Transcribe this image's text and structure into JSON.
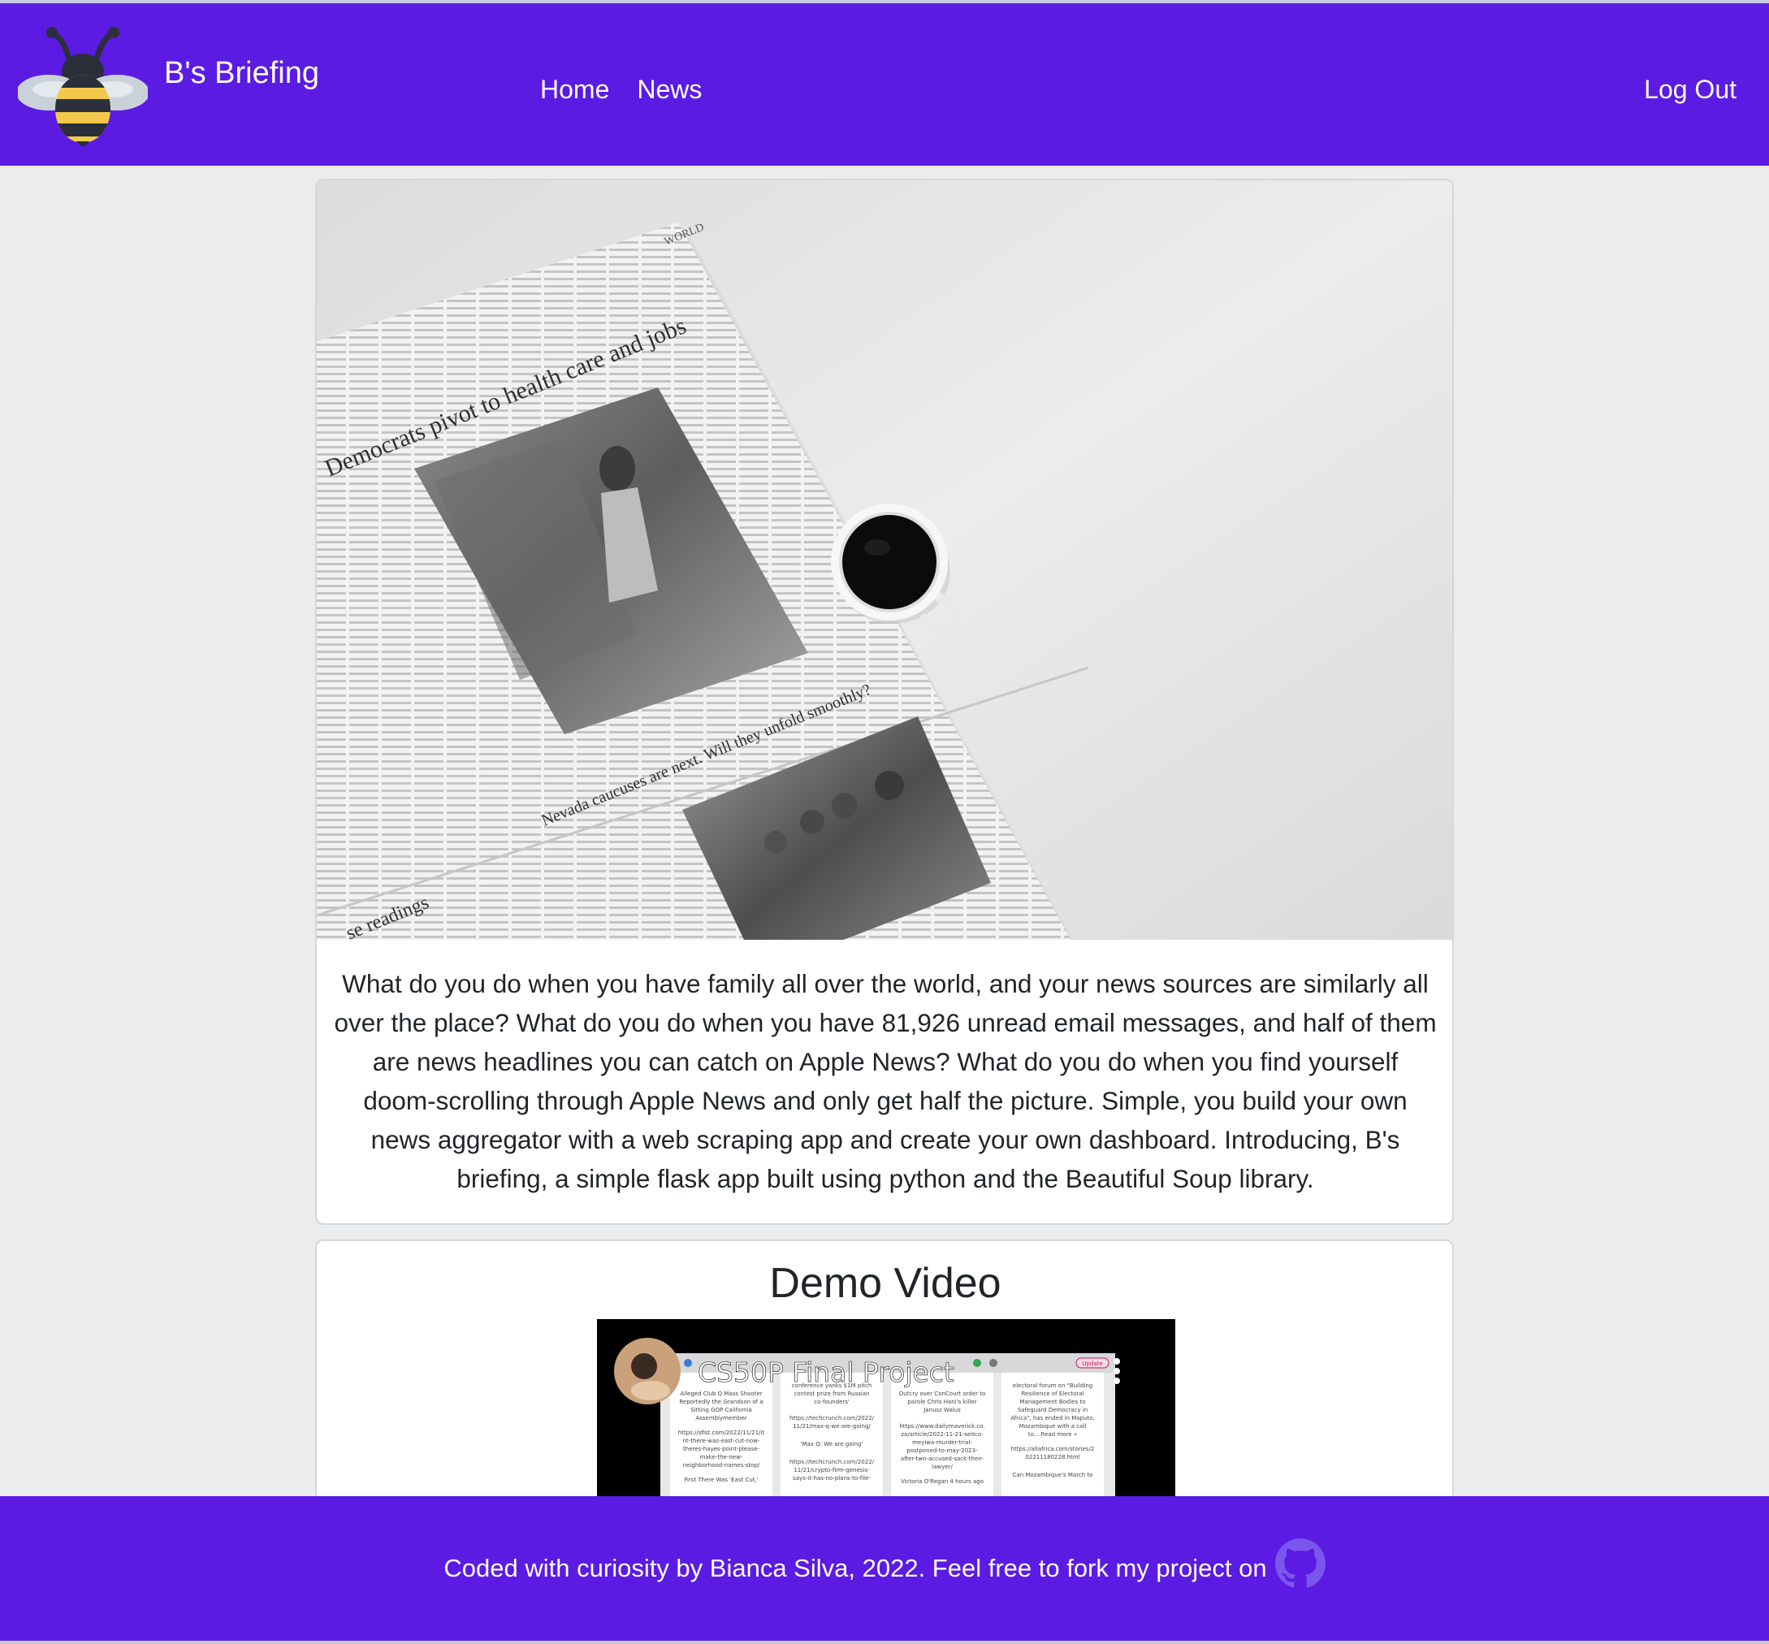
{
  "navbar": {
    "brand": "B's Briefing",
    "links": [
      {
        "label": "Home"
      },
      {
        "label": "News"
      }
    ],
    "logout_label": "Log Out"
  },
  "hero": {
    "headline_1": "Democrats pivot to health care and jobs",
    "headline_2": "Nevada caucuses are next. Will they unfold smoothly?",
    "section_label": "WORLD",
    "corner_text": "se readings"
  },
  "intro": {
    "text": "What do you do when you have family all over the world, and your news sources are similarly all over the place? What do you do when you have 81,926 unread email messages, and half of them are news headlines you can catch on Apple News? What do you do when you find yourself doom-scrolling through Apple News and only get half the picture. Simple, you build your own news aggregator with a web scraping app and create your own dashboard. Introducing, B's briefing, a simple flask app built using python and the Beautiful Soup library."
  },
  "video": {
    "heading": "Demo Video",
    "title": "CS50P Final Project",
    "columns": [
      {
        "lines": [
          "Alleged Club Q Mass Shooter",
          "Reportedly the Grandson of a",
          "Sitting GOP California",
          "Assemblymember",
          "https://sfist.com/2022/11/21/it",
          "nt-there-was-east-cut-now-",
          "theres-hayes-point-please-",
          "make-the-new-",
          "neighborhood-names-stop/",
          "First There Was 'East Cut,'"
        ]
      },
      {
        "lines": [
          "conference yanks $1M pitch",
          "contest prize from Russian",
          "co-founders'",
          "https://techcrunch.com/2022/",
          "11/21/max-q-we-are-going/",
          "'Max Q: We are going'",
          "https://techcrunch.com/2022/",
          "11/21/crypto-firm-genesis-",
          "says-it-has-no-plans-to-file-"
        ]
      },
      {
        "lines": [
          "Outcry over ConCourt order to",
          "parole Chris Hani's killer",
          "Janusz Walus",
          "https://www.dailymaverick.co.",
          "za/article/2022-11-21-seitco-",
          "meyiwa-murder-trial-",
          "postponed-to-may-2023-",
          "after-two-accused-sack-their-",
          "lawyer/",
          "Victoria O'Regan 4 hours ago"
        ]
      },
      {
        "lines": [
          "electoral forum on \"Building",
          "Resilience of Electoral",
          "Management Bodies to",
          "Safeguard Democracy in",
          "Africa\", has ended in Maputo,",
          "Mozambique with a call",
          "to... Read more »",
          "https://allafrica.com/stories/2",
          "02211180228.html",
          "Can Mozambique's March to"
        ]
      }
    ],
    "update_label": "Update"
  },
  "footer": {
    "text": "Coded with curiosity by Bianca Silva, 2022. Feel free to fork my project on"
  },
  "colors": {
    "primary": "#5b1be3",
    "page_bg": "#ebecee",
    "text": "#212529"
  },
  "icons": {
    "logo": "bee-logo-icon",
    "github": "github-icon",
    "menu": "more-vert-icon"
  }
}
